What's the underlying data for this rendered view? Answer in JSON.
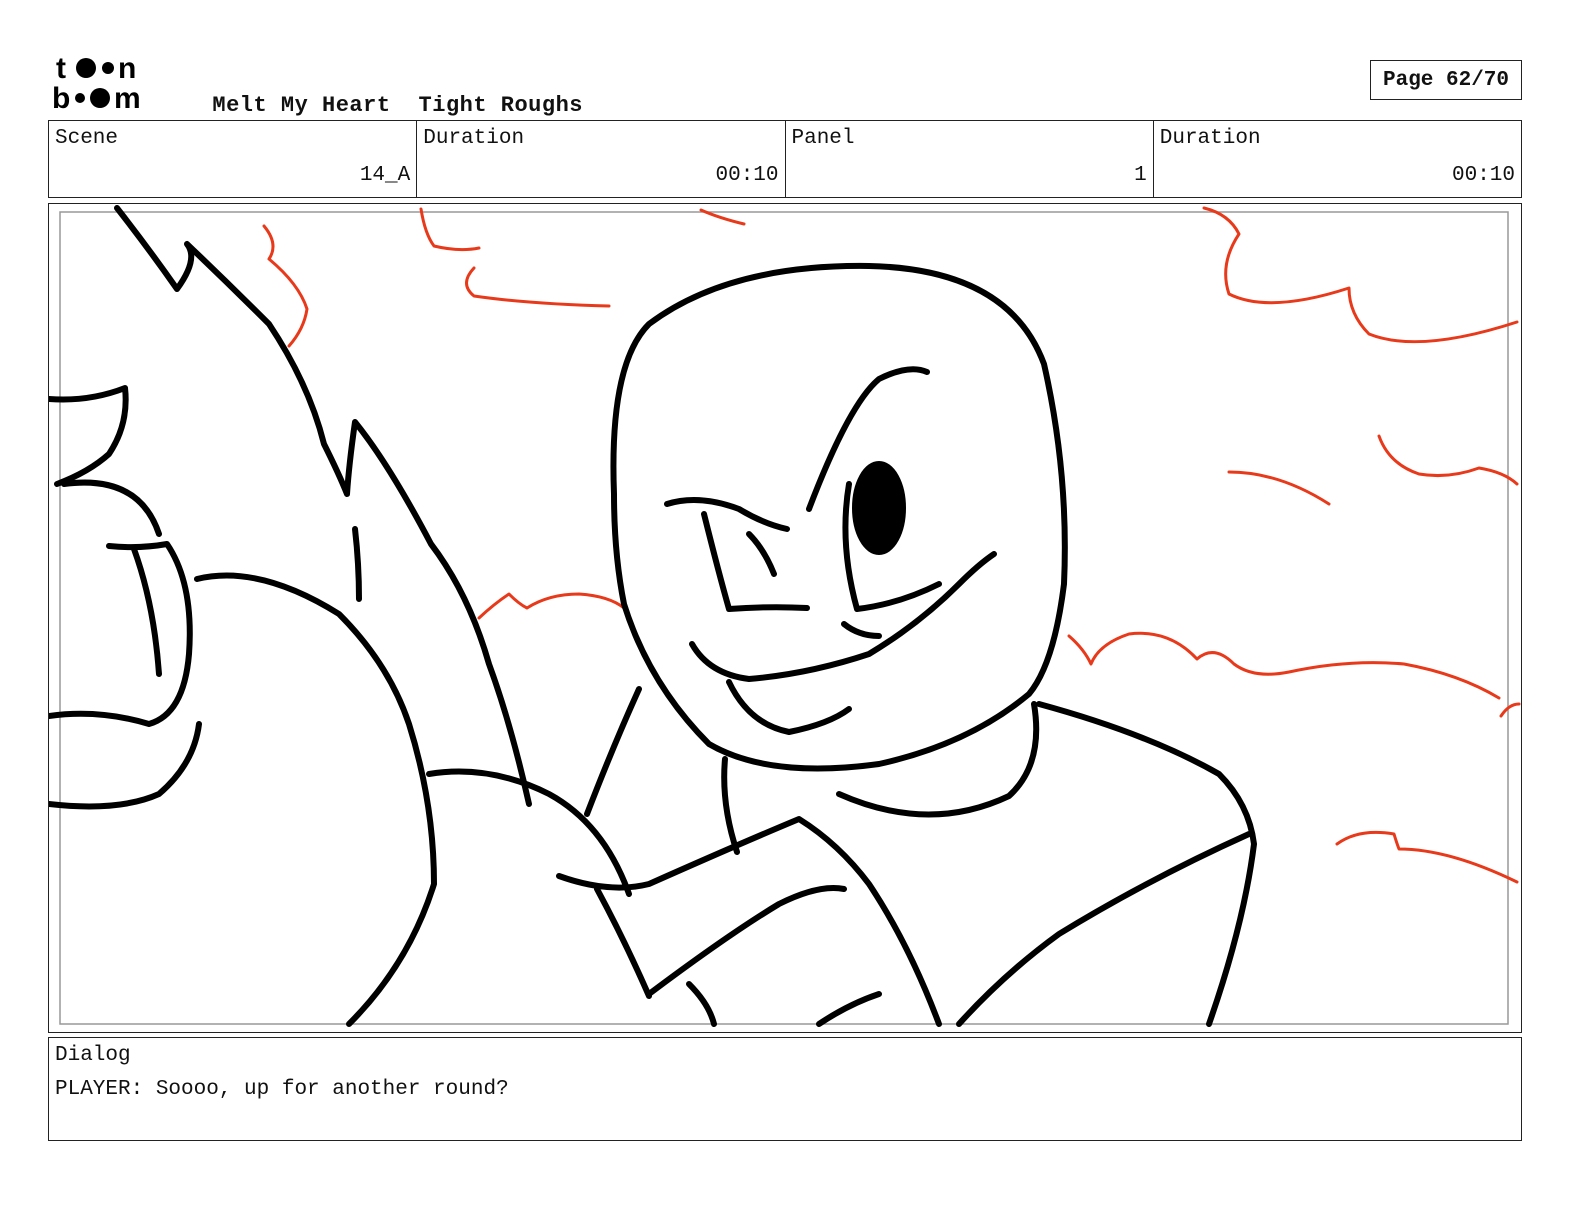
{
  "header": {
    "logo_text": "toon boom",
    "project": "Melt My Heart",
    "stage": "Tight Roughs",
    "page": "Page 62/70"
  },
  "info": {
    "scene_label": "Scene",
    "scene_value": "14_A",
    "duration_label": "Duration",
    "duration_value": "00:10",
    "panel_label": "Panel",
    "panel_value": "1",
    "panel_duration_label": "Duration",
    "panel_duration_value": "00:10"
  },
  "dialog": {
    "label": "Dialog",
    "text": "PLAYER: Soooo, up for another round?"
  },
  "colors": {
    "sketch_line": "#000000",
    "accent_line": "#e8391a"
  }
}
